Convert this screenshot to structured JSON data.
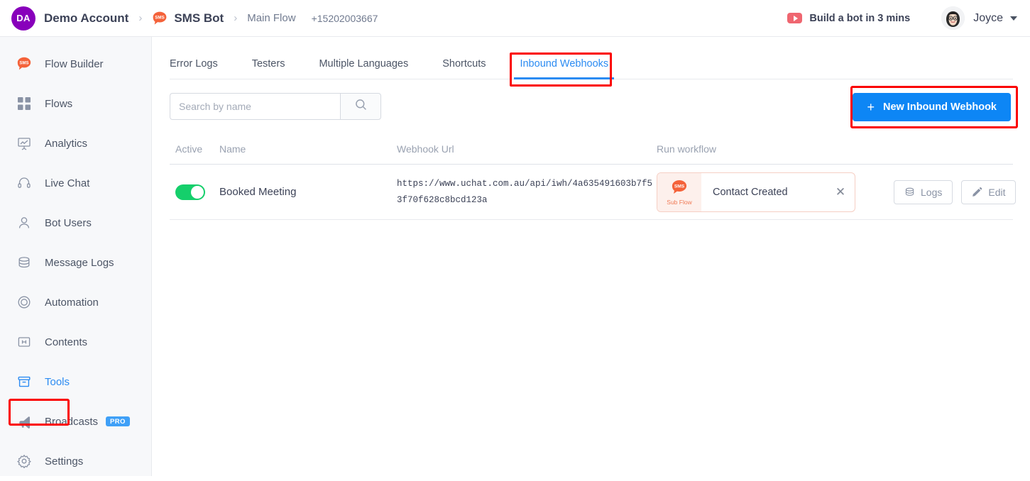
{
  "topbar": {
    "account_initials": "DA",
    "account_name": "Demo Account",
    "separator": "›",
    "bot_name": "SMS Bot",
    "flow_name": "Main Flow",
    "phone_number": "+15202003667",
    "youtube_label": "Build a bot in 3 mins",
    "user_name": "Joyce"
  },
  "sidebar": {
    "items": [
      {
        "label": "Flow Builder",
        "icon": "sms-bubble-icon",
        "active": false,
        "badge": ""
      },
      {
        "label": "Flows",
        "icon": "grid-icon",
        "active": false,
        "badge": ""
      },
      {
        "label": "Analytics",
        "icon": "chart-board-icon",
        "active": false,
        "badge": ""
      },
      {
        "label": "Live Chat",
        "icon": "headset-icon",
        "active": false,
        "badge": ""
      },
      {
        "label": "Bot Users",
        "icon": "user-icon",
        "active": false,
        "badge": ""
      },
      {
        "label": "Message Logs",
        "icon": "database-icon",
        "active": false,
        "badge": ""
      },
      {
        "label": "Automation",
        "icon": "target-icon",
        "active": false,
        "badge": ""
      },
      {
        "label": "Contents",
        "icon": "content-box-icon",
        "active": false,
        "badge": ""
      },
      {
        "label": "Tools",
        "icon": "archive-box-icon",
        "active": true,
        "badge": ""
      },
      {
        "label": "Broadcasts",
        "icon": "megaphone-icon",
        "active": false,
        "badge": "PRO"
      },
      {
        "label": "Settings",
        "icon": "gear-icon",
        "active": false,
        "badge": ""
      }
    ]
  },
  "tabs": [
    {
      "label": "Error Logs",
      "selected": false
    },
    {
      "label": "Testers",
      "selected": false
    },
    {
      "label": "Multiple Languages",
      "selected": false
    },
    {
      "label": "Shortcuts",
      "selected": false
    },
    {
      "label": "Inbound Webhooks",
      "selected": true
    }
  ],
  "toolbar": {
    "search_placeholder": "Search by name",
    "search_value": "",
    "new_button_label": "New Inbound Webhook",
    "new_button_plus": "+"
  },
  "table": {
    "columns": [
      "Active",
      "Name",
      "Webhook Url",
      "Run workflow"
    ],
    "rows": [
      {
        "active": true,
        "name": "Booked Meeting",
        "url": "https://www.uchat.com.au/api/iwh/4a635491603b7f53f70f628c8bcd123a",
        "flow_badge": "Sub Flow",
        "flow_label": "Contact Created",
        "flow_close": "✕",
        "logs_label": "Logs",
        "edit_label": "Edit"
      }
    ]
  },
  "colors": {
    "accent_blue": "#2b8bf2",
    "primary_button": "#0d86f5",
    "highlight_red": "#fb0000",
    "toggle_green": "#15cf6b",
    "sms_orange": "#f4623a",
    "account_purple": "#8800bb"
  }
}
